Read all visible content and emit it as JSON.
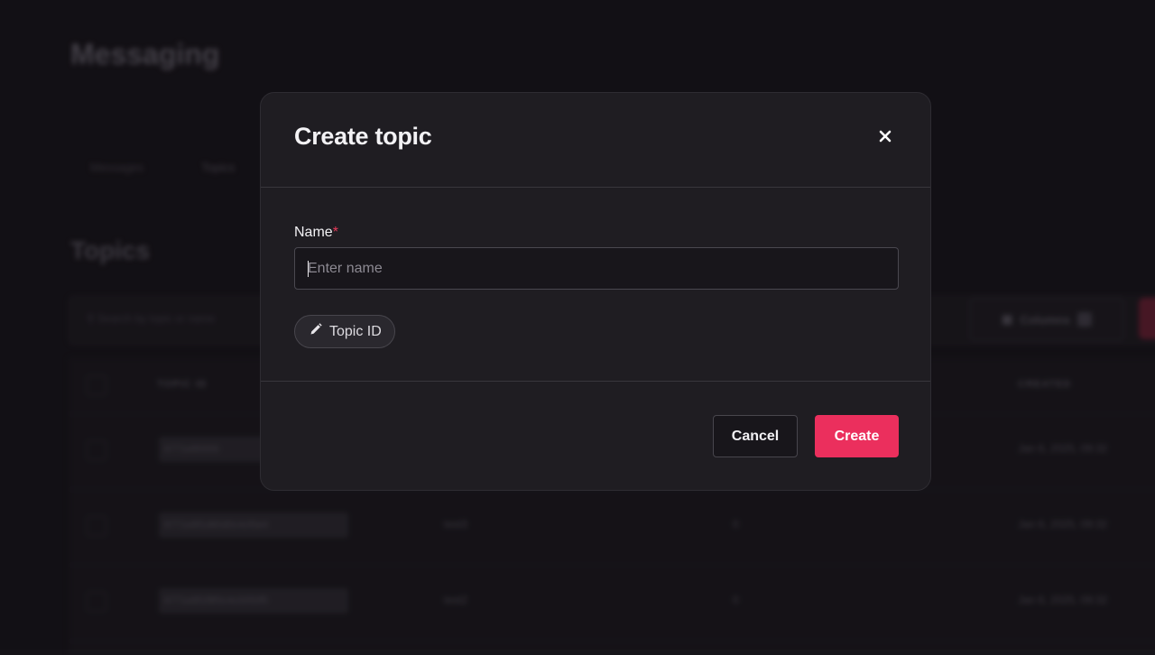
{
  "background": {
    "page_title": "Messaging",
    "tabs": [
      "Messages",
      "Topics"
    ],
    "section_title": "Topics",
    "search_placeholder": "Search by topic or name",
    "columns_label": "Columns",
    "table_headers": [
      "TOPIC ID",
      "CREATED"
    ],
    "rows": [
      {
        "id": "6771e80000",
        "name": "",
        "count": "",
        "created": "Jan 6, 2025, 09:32"
      },
      {
        "id": "6771e8f1d80d0c4cf0e4",
        "name": "test3",
        "count": "0",
        "created": "Jan 6, 2025, 09:32"
      },
      {
        "id": "6771e8f1f8f0c4c0050f5",
        "name": "test2",
        "count": "0",
        "created": "Jan 6, 2025, 09:32"
      }
    ]
  },
  "modal": {
    "title": "Create topic",
    "close_icon": "close-icon",
    "name_label": "Name",
    "required_marker": "*",
    "name_value": "",
    "name_placeholder": "Enter name",
    "topic_id_chip_label": "Topic ID",
    "topic_id_icon": "pencil-icon",
    "cancel_label": "Cancel",
    "create_label": "Create"
  },
  "colors": {
    "accent": "#eb2f5d",
    "required": "#e63b5a",
    "modal_bg": "#1f1d22",
    "page_bg": "#151318"
  }
}
